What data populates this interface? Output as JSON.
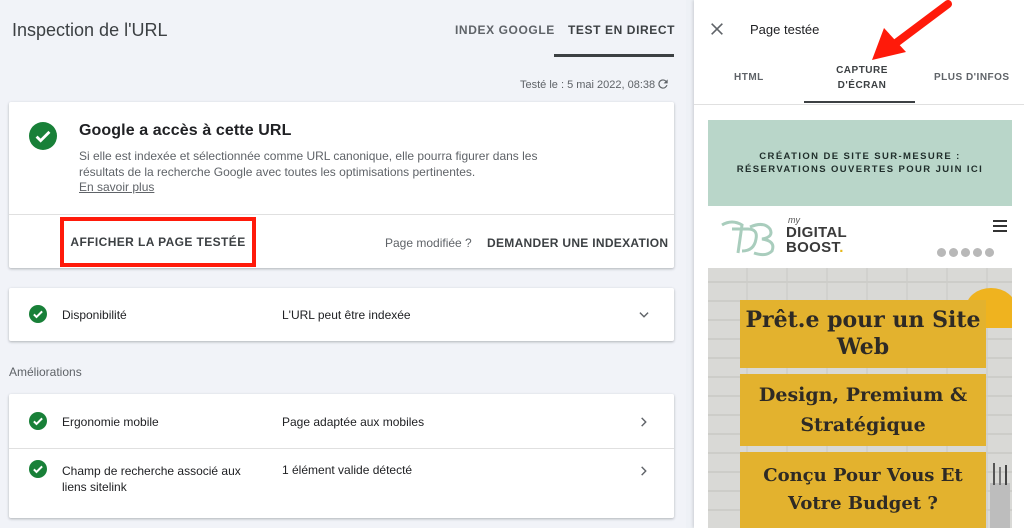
{
  "header": {
    "title": "Inspection de l'URL",
    "tabs": [
      {
        "label": "INDEX GOOGLE",
        "active": false
      },
      {
        "label": "TEST EN DIRECT",
        "active": true
      }
    ]
  },
  "test_info": {
    "tested_label": "Testé le : 5 mai 2022, 08:38",
    "refresh_icon": "refresh-icon"
  },
  "status_card": {
    "heading": "Google a accès à cette URL",
    "description": "Si elle est indexée et sélectionnée comme URL canonique, elle pourra figurer dans les résultats de la recherche Google avec toutes les optimisations pertinentes.",
    "learn_more": "En savoir plus",
    "view_tested_page": "AFFICHER LA PAGE TESTÉE",
    "page_modified": "Page modifiée ?",
    "request_indexing": "DEMANDER UNE INDEXATION",
    "highlight_color": "#ff1a0a",
    "status_color": "#188038"
  },
  "availability": {
    "label": "Disponibilité",
    "value": "L'URL peut être indexée"
  },
  "enhancements": {
    "section_label": "Améliorations",
    "rows": [
      {
        "label": "Ergonomie mobile",
        "value": "Page adaptée aux mobiles"
      },
      {
        "label": "Champ de recherche associé aux liens sitelink",
        "value": "1 élément valide détecté"
      }
    ]
  },
  "panel": {
    "title": "Page testée",
    "tabs": [
      {
        "label": "HTML",
        "active": false
      },
      {
        "label": "CAPTURE D'ÉCRAN",
        "active": true
      },
      {
        "label": "PLUS D'INFOS",
        "active": false
      }
    ],
    "annotation_arrow_color": "#ff1a0a"
  },
  "screenshot": {
    "banner": "CRÉATION DE SITE SUR-MESURE : RÉSERVATIONS OUVERTES POUR JUIN ICI",
    "logo_my": "my",
    "logo_line1": "DIGITAL",
    "logo_line2": "BOOST",
    "logo_dot": ".",
    "hero_1": "Prêt.e pour un Site Web",
    "hero_2": "Design, Premium & Stratégique",
    "hero_3": "Conçu Pour Vous Et Votre Budget ?",
    "banner_color": "#b9d6c9",
    "accent_color": "#e3b22e"
  }
}
